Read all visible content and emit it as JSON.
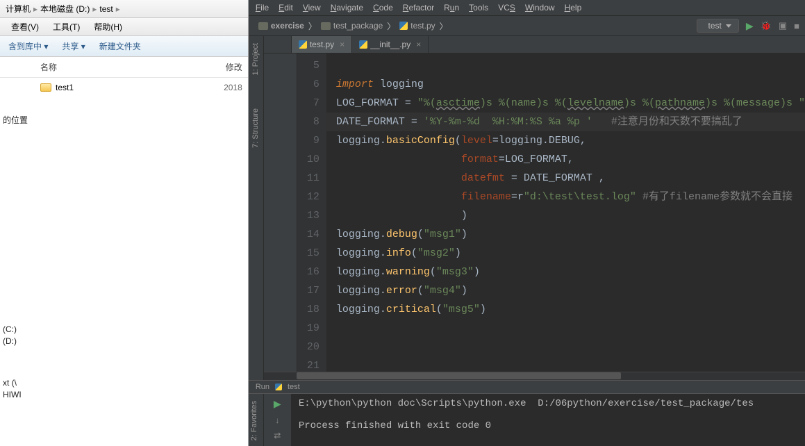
{
  "explorer": {
    "path": [
      "计算机",
      "本地磁盘 (D:)",
      "test"
    ],
    "menus": [
      "查看(V)",
      "工具(T)",
      "帮助(H)"
    ],
    "toolbar": [
      "含到库中 ▾",
      "共享 ▾",
      "新建文件夹"
    ],
    "headers": {
      "blank": "",
      "name": "名称",
      "mod": "修改"
    },
    "rows": [
      {
        "name": "test1",
        "mod": "2018"
      }
    ],
    "left_labels": [
      "的位置",
      "(C:)",
      "(D:)",
      "xt (\\",
      "HIWI"
    ]
  },
  "ide": {
    "menu": [
      {
        "u": "F",
        "rest": "ile"
      },
      {
        "u": "E",
        "rest": "dit"
      },
      {
        "u": "V",
        "rest": "iew"
      },
      {
        "u": "N",
        "rest": "avigate"
      },
      {
        "u": "C",
        "rest": "ode"
      },
      {
        "u": "R",
        "rest": "efactor"
      },
      {
        "u": "",
        "rest": "R",
        "u2": "u",
        "rest2": "n"
      },
      {
        "u": "T",
        "rest": "ools"
      },
      {
        "u": "",
        "rest": "VC",
        "u2": "S",
        "rest2": ""
      },
      {
        "u": "W",
        "rest": "indow"
      },
      {
        "u": "H",
        "rest": "elp"
      }
    ],
    "breadcrumbs": [
      {
        "icon": "dir",
        "label": "exercise"
      },
      {
        "icon": "dir",
        "label": "test_package"
      },
      {
        "icon": "py",
        "label": "test.py"
      }
    ],
    "run_config": "test",
    "side_tabs": [
      "1: Project",
      "7: Structure"
    ],
    "tabs": [
      {
        "label": "test.py",
        "active": true
      },
      {
        "label": "__init__.py",
        "active": false
      }
    ],
    "gutter": [
      "5",
      "6",
      "7",
      "8",
      "9",
      "10",
      "11",
      "12",
      "13",
      "14",
      "15",
      "16",
      "17",
      "18",
      "19",
      "20",
      "21"
    ],
    "code": [
      {
        "html": ""
      },
      {
        "html": "<span class='kw'>import </span>logging"
      },
      {
        "html": "LOG_FORMAT = <span class='str'>\"%(<span class='underline'>asctime</span>)s %(name)s %(<span class='underline'>levelname</span>)s %(<span class='underline'>pathname</span>)s %(message)s \"</span>"
      },
      {
        "hl": true,
        "html": "DATE_FORMAT = <span class='str'>'%Y-%m-%d  %H:%M:%S %a %p '</span>   <span class='cmt'>#注意月份和天数不要搞乱了</span>"
      },
      {
        "html": "logging.<span class='fn'>basicConfig</span>(<span class='arg'>level</span>=logging.DEBUG,"
      },
      {
        "html": "                    <span class='arg'>format</span>=LOG_FORMAT,"
      },
      {
        "html": "                    <span class='arg'>datefmt</span> = DATE_FORMAT ,"
      },
      {
        "html": "                    <span class='arg'>filename</span>=r<span class='str'>\"d:\\test\\test.log\"</span> <span class='cmt'>#有了filename参数就不会直接</span>"
      },
      {
        "html": "                    )"
      },
      {
        "html": "logging.<span class='fn'>debug</span>(<span class='str'>\"msg1\"</span>)"
      },
      {
        "html": "logging.<span class='fn'>info</span>(<span class='str'>\"msg2\"</span>)"
      },
      {
        "html": "logging.<span class='fn'>warning</span>(<span class='str'>\"msg3\"</span>)"
      },
      {
        "html": "logging.<span class='fn'>error</span>(<span class='str'>\"msg4\"</span>)"
      },
      {
        "html": "logging.<span class='fn'>critical</span>(<span class='str'>\"msg5\"</span>)"
      },
      {
        "html": ""
      },
      {
        "html": ""
      },
      {
        "html": ""
      }
    ],
    "run": {
      "label": "Run",
      "config": "test",
      "output": "E:\\python\\python doc\\Scripts\\python.exe  D:/06python/exercise/test_package/tes\n\nProcess finished with exit code 0"
    },
    "favorites_tab": "2: Favorites"
  }
}
